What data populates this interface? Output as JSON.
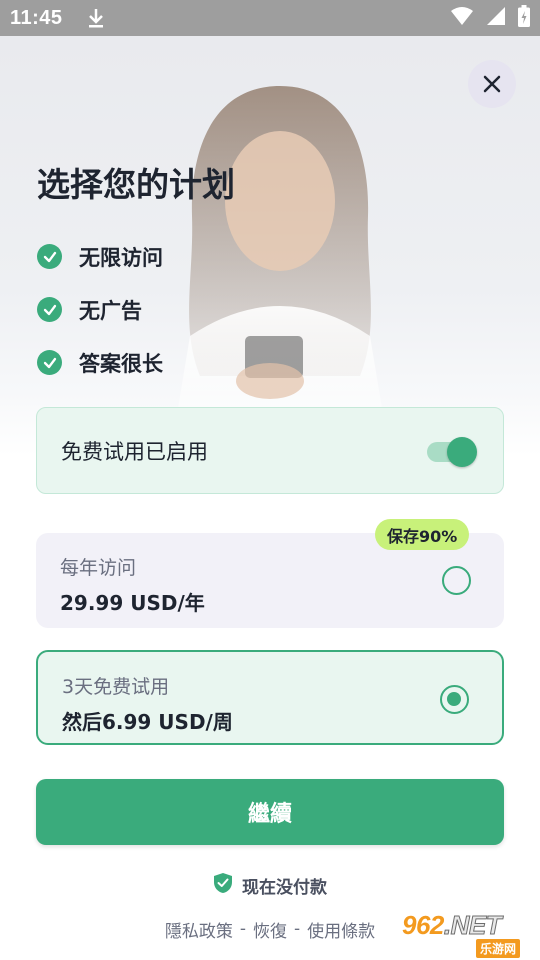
{
  "status_bar": {
    "time": "11:45",
    "icons": [
      "download-icon",
      "wifi-icon",
      "signal-icon",
      "battery-icon"
    ]
  },
  "header": {
    "title": "选择您的计划",
    "close_icon": "close-icon"
  },
  "features": [
    {
      "label": "无限访问",
      "icon": "check-circle-icon"
    },
    {
      "label": "无广告",
      "icon": "check-circle-icon"
    },
    {
      "label": "答案很长",
      "icon": "check-circle-icon"
    }
  ],
  "free_trial": {
    "label": "免费试用已启用",
    "enabled": true
  },
  "plans": [
    {
      "name": "每年访问",
      "price": "29.99 USD/年",
      "selected": false,
      "badge": "保存90%"
    },
    {
      "name": "3天免费试用",
      "price": "然后6.99 USD/周",
      "selected": true
    }
  ],
  "cta": {
    "label": "繼續"
  },
  "no_payment": {
    "label": "现在没付款",
    "icon": "shield-check-icon"
  },
  "footer": {
    "privacy": "隱私政策",
    "restore": "恢復",
    "terms": "使用條款",
    "separator": "-"
  },
  "watermark": {
    "brand_top": "962",
    "brand_net": ".NET",
    "brand_bottom": "乐游网"
  },
  "colors": {
    "accent": "#3aab7c",
    "badge": "#c8f17a",
    "selected_card": "#e9f6f0",
    "unselected_card": "#f2f1f8"
  }
}
